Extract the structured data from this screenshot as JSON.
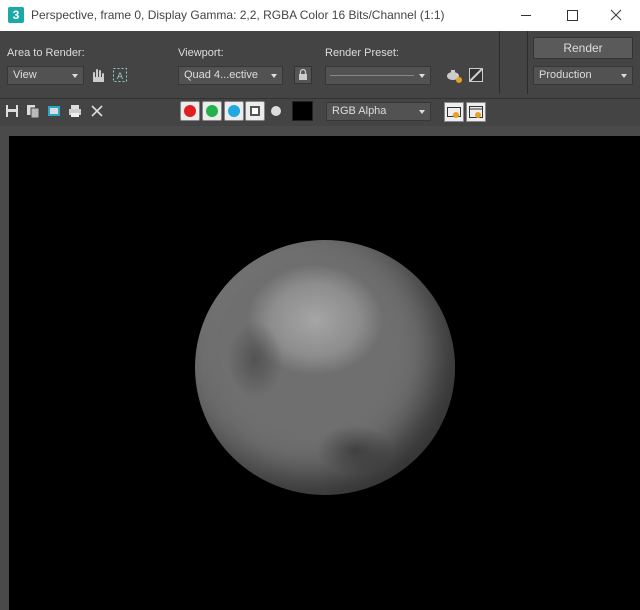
{
  "window": {
    "app_icon_text": "3",
    "title": "Perspective, frame 0, Display Gamma: 2,2, RGBA Color 16 Bits/Channel (1:1)"
  },
  "toolbar": {
    "area_to_render_label": "Area to Render:",
    "area_to_render_value": "View",
    "viewport_label": "Viewport:",
    "viewport_value": "Quad 4...ective",
    "render_preset_label": "Render Preset:",
    "render_preset_value": "",
    "render_button_label": "Render",
    "production_value": "Production"
  },
  "display": {
    "channel_value": "RGB Alpha",
    "channel_colors": {
      "red": "#e02020",
      "green": "#22b14c",
      "blue": "#20a8e0"
    }
  }
}
